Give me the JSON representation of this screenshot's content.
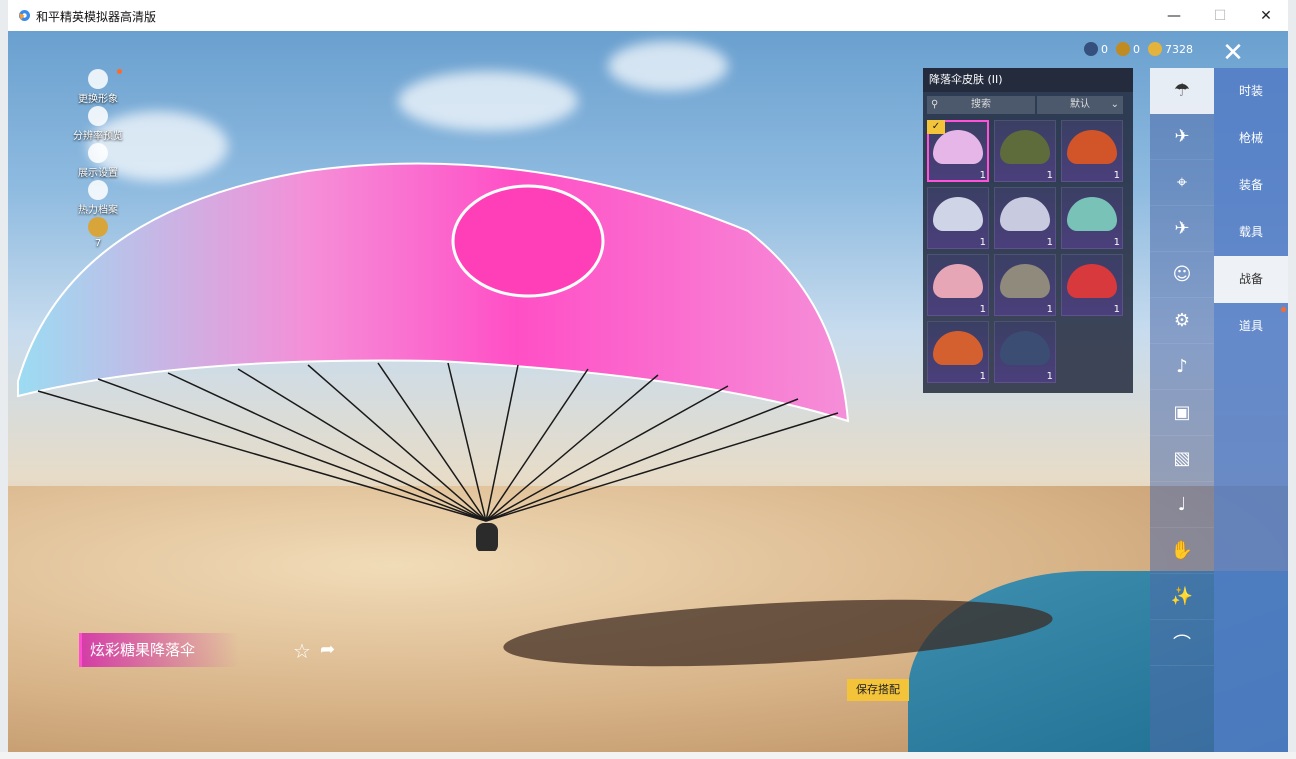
{
  "window": {
    "title": "和平精英模拟器高清版"
  },
  "currency": [
    {
      "icon": "globe-coin-icon",
      "value": "0",
      "color": "#35507c"
    },
    {
      "icon": "badge-coin-icon",
      "value": "0",
      "color": "#c08b20"
    },
    {
      "icon": "gold-coin-icon",
      "value": "7328",
      "color": "#e3b33c"
    }
  ],
  "left_menu": [
    {
      "label": "更换形象",
      "icon": "person-icon"
    },
    {
      "label": "分辨率预览",
      "icon": "gear-icon"
    },
    {
      "label": "展示设置",
      "icon": "eye-icon"
    },
    {
      "label": "热力档案",
      "icon": "flame-icon"
    },
    {
      "label": "7",
      "icon": "level-badge-icon"
    }
  ],
  "panel": {
    "title": "降落伞皮肤 (II)",
    "search_label": "搜索",
    "sort_label": "默认"
  },
  "items": [
    {
      "count": "1",
      "color": "#e7b6e8",
      "selected": true
    },
    {
      "count": "1",
      "color": "#5e6b3b",
      "selected": false
    },
    {
      "count": "1",
      "color": "#d2552a",
      "selected": false
    },
    {
      "count": "1",
      "color": "#cfd4e6",
      "selected": false
    },
    {
      "count": "1",
      "color": "#c8cbe0",
      "selected": false
    },
    {
      "count": "1",
      "color": "#78c2b8",
      "selected": false
    },
    {
      "count": "1",
      "color": "#e7a6b5",
      "selected": false
    },
    {
      "count": "1",
      "color": "#8f8a7c",
      "selected": false
    },
    {
      "count": "1",
      "color": "#d8393c",
      "selected": false
    },
    {
      "count": "1",
      "color": "#d5602f",
      "selected": false
    },
    {
      "count": "1",
      "color": "#3c4d73",
      "selected": false
    }
  ],
  "sub_tabs": [
    "parachute",
    "glider",
    "drone",
    "plane",
    "face",
    "robot",
    "speaker",
    "box",
    "photo",
    "flare",
    "hand",
    "wand",
    "hat"
  ],
  "categories": [
    {
      "label": "时装",
      "active": false
    },
    {
      "label": "枪械",
      "active": false
    },
    {
      "label": "装备",
      "active": false
    },
    {
      "label": "载具",
      "active": false
    },
    {
      "label": "战备",
      "active": true
    },
    {
      "label": "道具",
      "active": false
    }
  ],
  "item_name": "炫彩糖果降落伞",
  "save_button": "保存搭配"
}
